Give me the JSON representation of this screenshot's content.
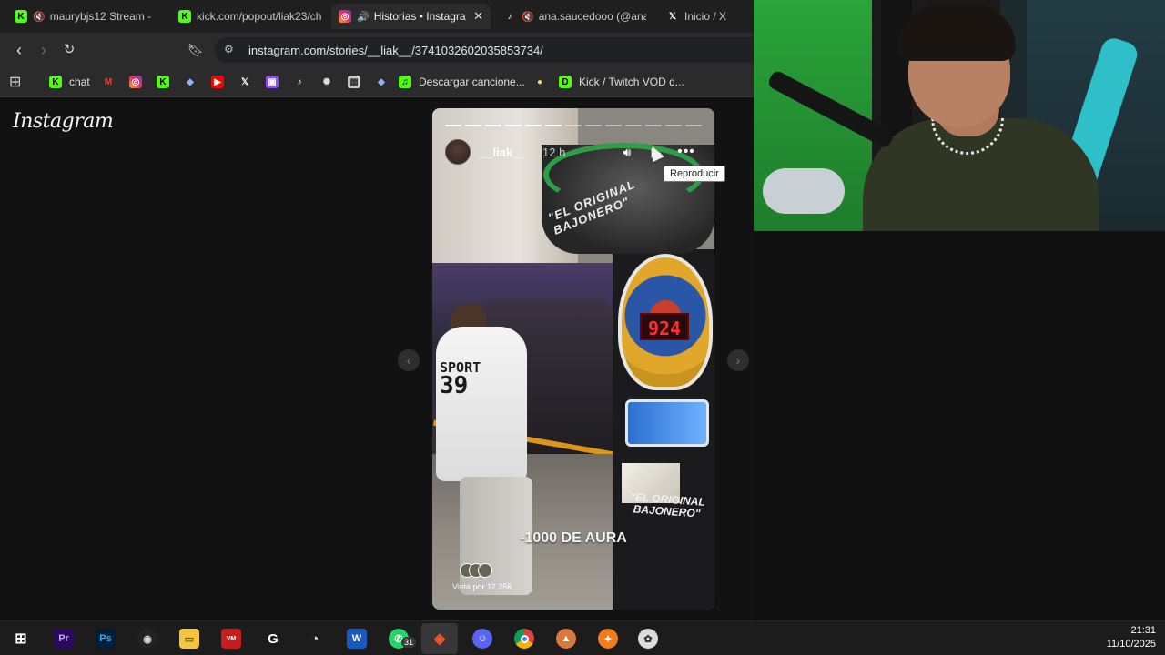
{
  "tabs": [
    {
      "title": "maurybjs12 Stream - W",
      "icon": "kick-icon",
      "color": "#53fc18",
      "muted": true
    },
    {
      "title": "kick.com/popout/liak23/ch",
      "icon": "kick-icon",
      "color": "#53fc18",
      "muted": false
    },
    {
      "title": "Historias • Instagra",
      "icon": "instagram-icon",
      "color": "#e1306c",
      "muted": false,
      "audio": true,
      "active": true
    },
    {
      "title": "ana.saucedooo (@ana.",
      "icon": "tiktok-icon",
      "color": "#ffffff",
      "muted": true
    },
    {
      "title": "Inicio / X",
      "icon": "x-icon",
      "color": "#ffffff",
      "muted": false
    }
  ],
  "address": {
    "url": "instagram.com/stories/__liak__/3741032602035853734/"
  },
  "bookmarks": [
    {
      "label": "chat",
      "icon": "kick-icon",
      "color": "#53fc18"
    },
    {
      "label": "",
      "icon": "gmail-icon",
      "color": "#ea4335"
    },
    {
      "label": "",
      "icon": "instagram-icon",
      "color": "#e1306c"
    },
    {
      "label": "",
      "icon": "kick-icon",
      "color": "#53fc18"
    },
    {
      "label": "",
      "icon": "ethereum-icon",
      "color": "#8ab4f8"
    },
    {
      "label": "",
      "icon": "youtube-icon",
      "color": "#ff0000"
    },
    {
      "label": "",
      "icon": "x-icon",
      "color": "#ffffff"
    },
    {
      "label": "",
      "icon": "twitch-icon",
      "color": "#9146ff"
    },
    {
      "label": "",
      "icon": "tiktok-icon",
      "color": "#ffffff"
    },
    {
      "label": "",
      "icon": "openai-icon",
      "color": "#dddddd"
    },
    {
      "label": "",
      "icon": "image-icon",
      "color": "#cccccc"
    },
    {
      "label": "",
      "icon": "ethereum-icon",
      "color": "#8ab4f8"
    },
    {
      "label": "Descargar cancione...",
      "icon": "download-music-icon",
      "color": "#53fc18"
    },
    {
      "label": "",
      "icon": "coin-icon",
      "color": "#f4d27a"
    },
    {
      "label": "Kick / Twitch VOD d...",
      "icon": "vod-icon",
      "color": "#53fc18"
    }
  ],
  "instagram": {
    "logo": "Instagram",
    "story": {
      "username": "__liak__",
      "age": "12 h",
      "segments_total": 13,
      "segments_done": 6,
      "caption": "-1000 DE AURA",
      "views": "Vista por 12.256",
      "arch_text": "\"EL ORIGINAL BAJONERO\"",
      "machine_text": "\"EL ORIGINAL BAJONERO\"",
      "jersey_text": "SPORT",
      "jersey_number": "39",
      "score_display": "924"
    },
    "tooltip": "Reproducir"
  },
  "taskbar": {
    "apps": [
      "windows-start-icon",
      "premiere-icon",
      "photoshop-icon",
      "obs-icon",
      "file-explorer-icon",
      "voicemeeter-icon",
      "g-hub-icon",
      "app-icon",
      "word-icon",
      "whatsapp-icon",
      "brave-icon",
      "discord-icon",
      "chrome-icon",
      "app-icon",
      "app-icon",
      "app-icon"
    ],
    "whatsapp_badge": "31",
    "time": "21:31",
    "date": "11/10/2025"
  }
}
